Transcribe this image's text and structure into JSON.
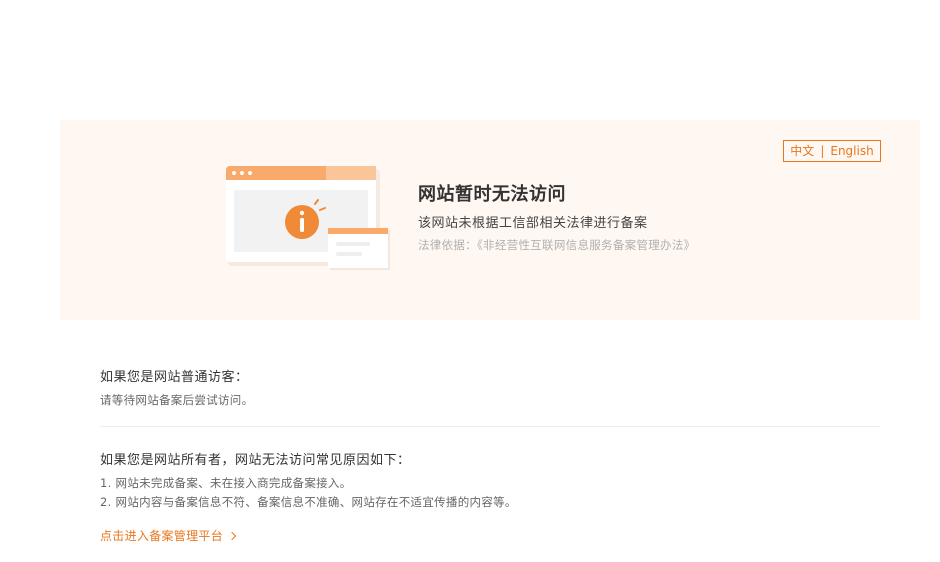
{
  "banner": {
    "lang_zh": "中文",
    "lang_sep": "|",
    "lang_en": "English",
    "headline": "网站暂时无法访问",
    "subline": "该网站未根据工信部相关法律进行备案",
    "law": "法律依据：《非经营性互联网信息服务备案管理办法》"
  },
  "visitor": {
    "title": "如果您是网站普通访客：",
    "text": "请等待网站备案后尝试访问。"
  },
  "owner": {
    "title": "如果您是网站所有者，网站无法访问常见原因如下：",
    "reasons": [
      "1. 网站未完成备案、未在接入商完成备案接入。",
      "2. 网站内容与备案信息不符、备案信息不准确、网站存在不适宜传播的内容等。"
    ]
  },
  "link": {
    "label": "点击进入备案管理平台"
  },
  "colors": {
    "accent": "#e8771e",
    "banner_bg": "#fff7f2"
  },
  "icons": {
    "illustration": "browser-window-info-icon",
    "chevron": "chevron-right-icon"
  }
}
